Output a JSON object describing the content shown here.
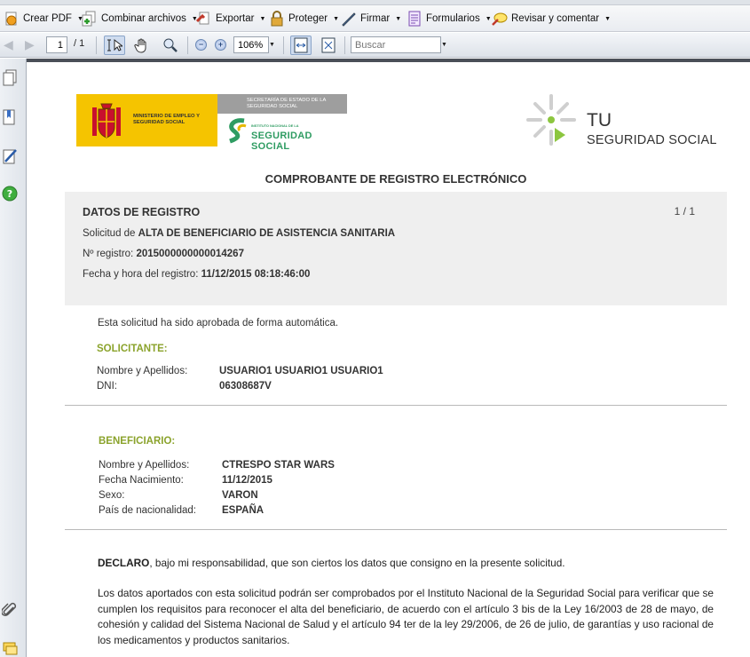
{
  "toolbar": {
    "create_pdf": "Crear PDF",
    "combine": "Combinar archivos",
    "export": "Exportar",
    "protect": "Proteger",
    "sign": "Firmar",
    "forms": "Formularios",
    "review": "Revisar y comentar"
  },
  "nav": {
    "page_current": "1",
    "page_total": "/ 1",
    "zoom": "106%",
    "search_placeholder": "Buscar"
  },
  "logos": {
    "ministry_text": "MINISTERIO DE EMPLEO Y SEGURIDAD SOCIAL",
    "ss_secretaria": "SECRETARÍA DE ESTADO DE LA SEGURIDAD SOCIAL",
    "ss_instituto": "INSTITUTO NACIONAL DE LA",
    "ss_name": "SEGURIDAD SOCIAL",
    "tu_line1": "TU",
    "tu_line2": "SEGURIDAD SOCIAL"
  },
  "document": {
    "title": "COMPROBANTE DE REGISTRO ELECTRÓNICO",
    "registro": {
      "heading": "DATOS DE REGISTRO",
      "page_indicator": "1 / 1",
      "solicitud_label": "Solicitud de",
      "solicitud_value": "ALTA DE BENEFICIARIO DE ASISTENCIA SANITARIA",
      "numero_label": "Nº registro:",
      "numero_value": "2015000000000014267",
      "fecha_label": "Fecha y hora del registro:",
      "fecha_value": "11/12/2015 08:18:46:00"
    },
    "approval_note": "Esta solicitud ha sido aprobada de forma automática.",
    "solicitante": {
      "heading": "SOLICITANTE:",
      "nombre_label": "Nombre y Apellidos:",
      "nombre_value": "USUARIO1 USUARIO1 USUARIO1",
      "dni_label": "DNI:",
      "dni_value": "06308687V"
    },
    "beneficiario": {
      "heading": "BENEFICIARIO:",
      "nombre_label": "Nombre y Apellidos:",
      "nombre_value": "CTRESPO STAR WARS",
      "nacimiento_label": "Fecha Nacimiento:",
      "nacimiento_value": "11/12/2015",
      "sexo_label": "Sexo:",
      "sexo_value": "VARON",
      "pais_label": "País de nacionalidad:",
      "pais_value": "ESPAÑA"
    },
    "declaro_bold": "DECLARO",
    "declaro_rest": ", bajo mi responsabilidad, que son ciertos los datos que consigno en la presente solicitud.",
    "legal_text": "Los datos aportados con esta solicitud podrán ser comprobados por el Instituto Nacional de la Seguridad Social para verificar que se cumplen los requisitos para reconocer el alta del beneficiario, de acuerdo con el artículo 3 bis de la Ley 16/2003 de 28 de mayo, de cohesión y calidad del Sistema Nacional de Salud y el artículo 94 ter de la ley 29/2006, de 26 de julio, de garantías y uso racional de los medicamentos y productos sanitarios."
  },
  "colors": {
    "accent_green": "#8ba32c",
    "ss_green": "#2f9c62",
    "ministry_yellow": "#f5c400"
  }
}
